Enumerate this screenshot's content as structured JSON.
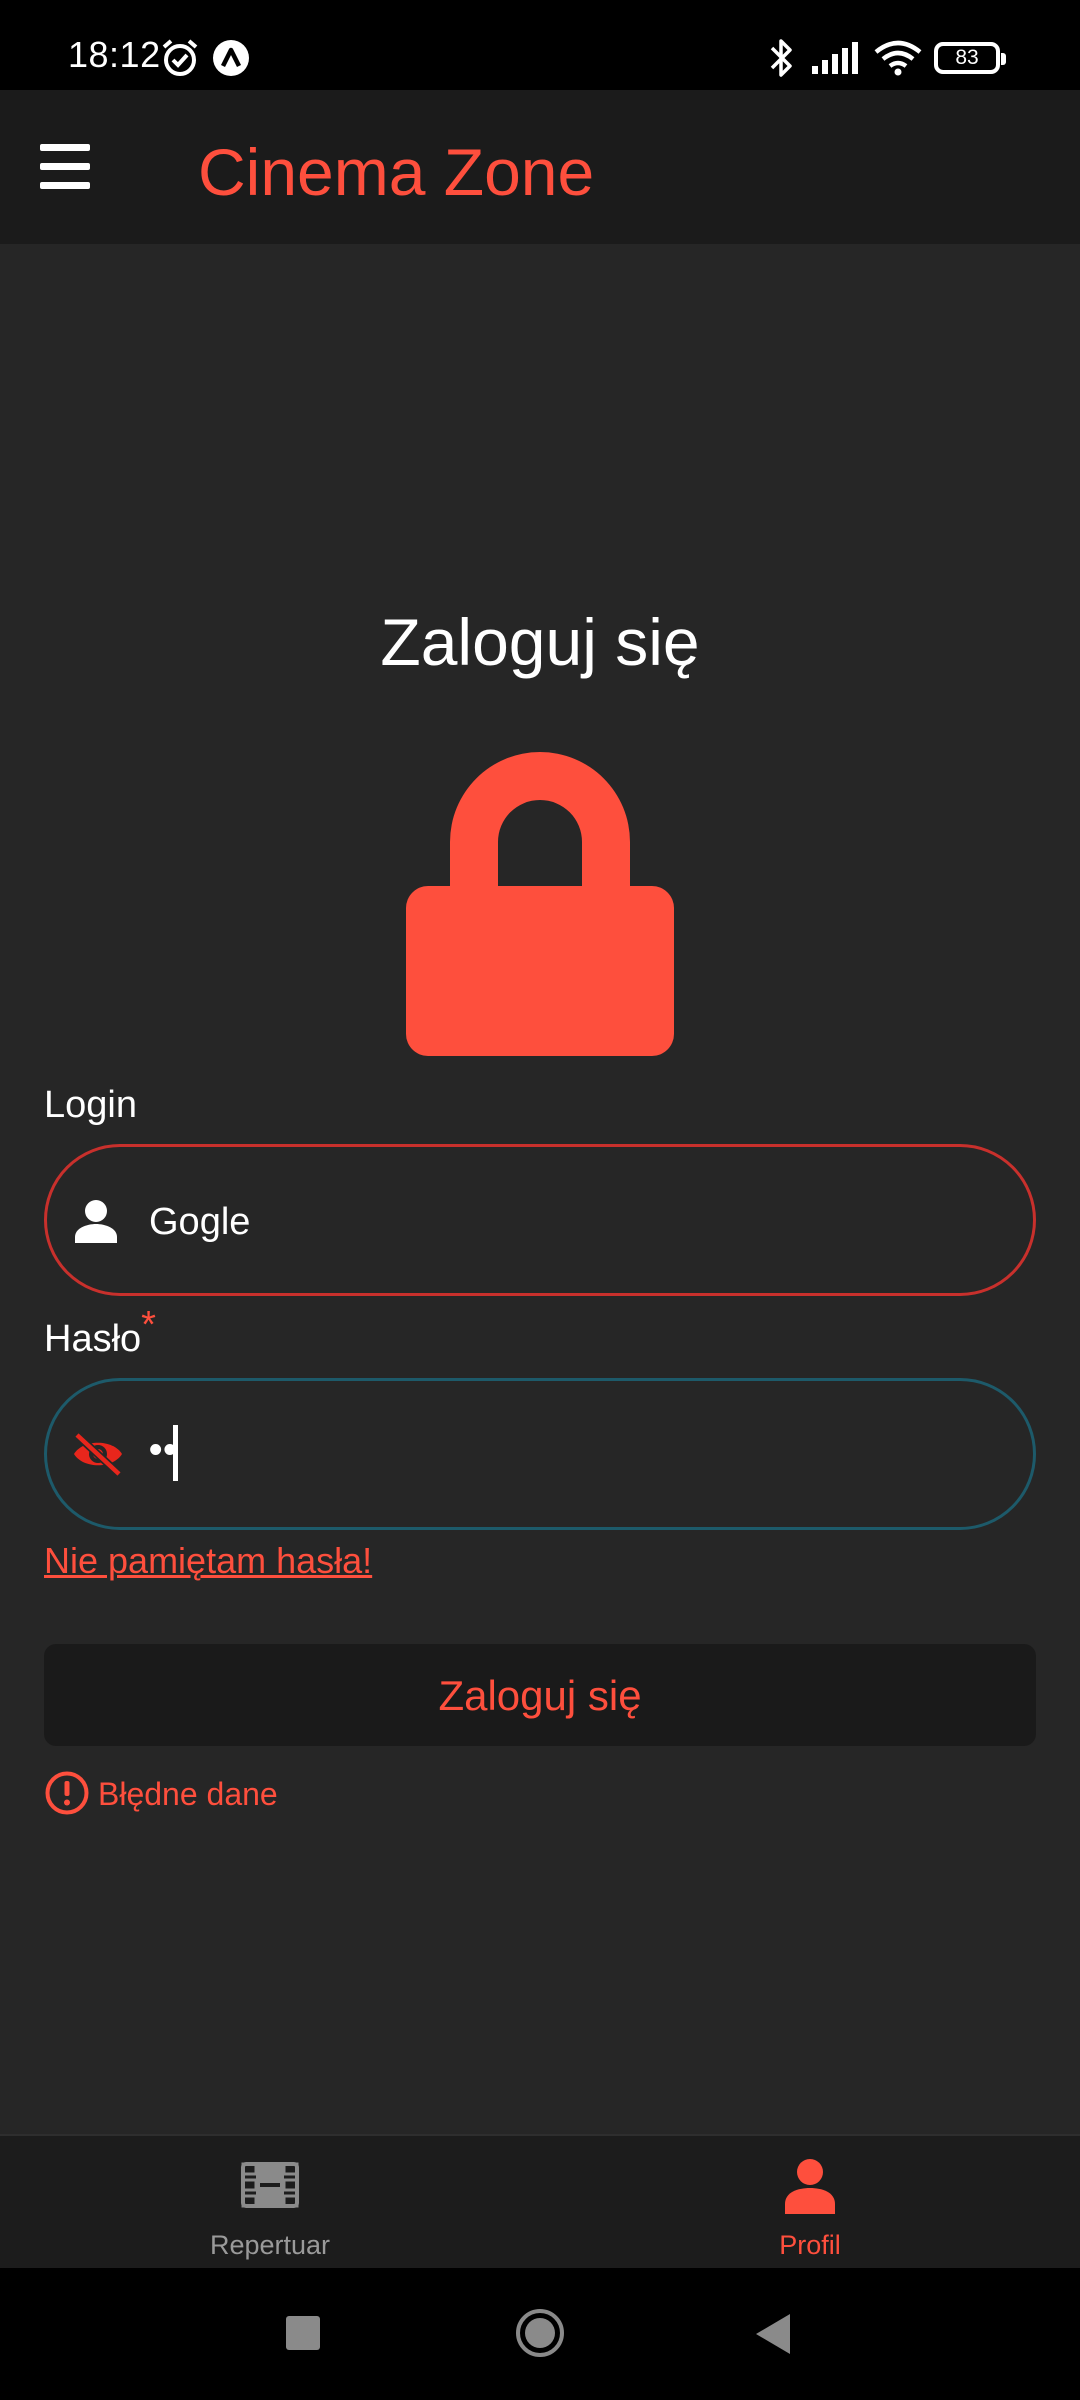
{
  "status_bar": {
    "time": "18:12",
    "battery": "83"
  },
  "app_bar": {
    "title": "Cinema Zone"
  },
  "login_form": {
    "heading": "Zaloguj się",
    "login_label": "Login",
    "login_value": "Gogle",
    "password_label": "Hasło",
    "required_marker": "*",
    "password_value": "••",
    "forgot_password": "Nie pamiętam hasła!",
    "submit_label": "Zaloguj się",
    "error_message": "Błędne dane"
  },
  "bottom_nav": {
    "items": [
      {
        "label": "Repertuar",
        "active": false
      },
      {
        "label": "Profil",
        "active": true
      }
    ]
  },
  "colors": {
    "accent": "#fe4f3d",
    "background": "#262626",
    "app_bar": "#1b1b1b",
    "error_border": "#c8302c",
    "focus_border": "#1d5a6a"
  },
  "icons": {
    "menu": "hamburger-menu-icon",
    "lock": "lock-icon",
    "user": "person-icon",
    "password_toggle": "eye-off-icon",
    "error": "alert-circle-icon",
    "repertoire": "film-icon",
    "profile": "person-icon"
  }
}
